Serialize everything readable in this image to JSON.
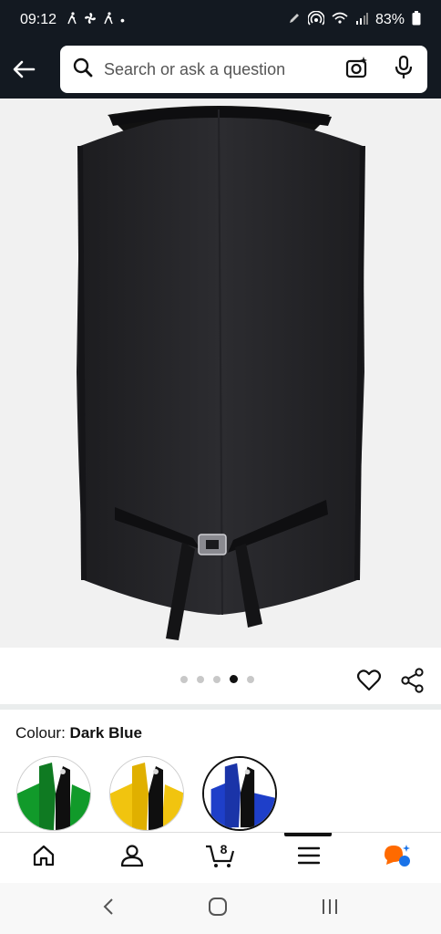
{
  "status_bar": {
    "time": "09:12",
    "battery": "83%",
    "dot": "•"
  },
  "search": {
    "placeholder": "Search or ask a question"
  },
  "product_image": {
    "description_icon": "vest-back-image"
  },
  "carousel": {
    "count": 5,
    "active_index": 3
  },
  "colour": {
    "label": "Colour:",
    "value": "Dark Blue",
    "options": [
      {
        "name": "Green",
        "color": "#1a9a2a"
      },
      {
        "name": "Yellow",
        "color": "#f1c40f"
      },
      {
        "name": "Dark Blue",
        "color": "#1e3fc9"
      }
    ]
  },
  "bottom_nav": {
    "cart_count": "8",
    "items": [
      "home-icon",
      "account-icon",
      "cart-icon",
      "menu-icon",
      "rufus-icon"
    ]
  },
  "colors": {
    "header_bg": "#131921",
    "accent": "#ff6a00"
  }
}
